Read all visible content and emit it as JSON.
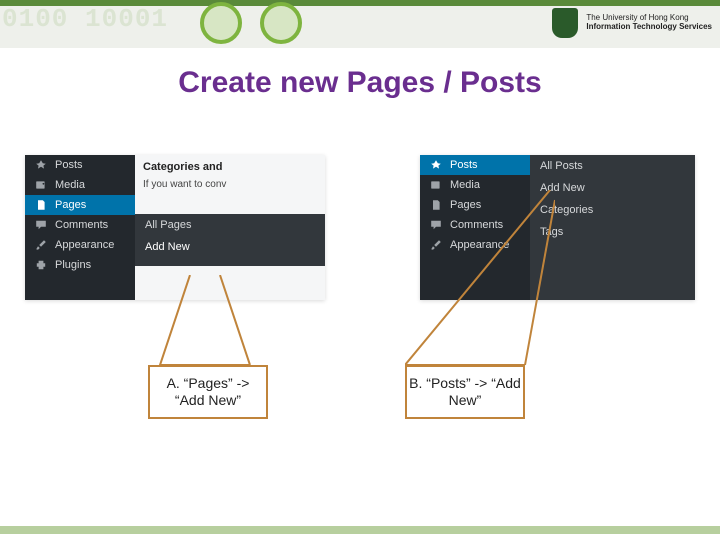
{
  "banner": {
    "binary_bg": "0100      10001",
    "org_line1": "The University of Hong Kong",
    "org_line2": "Information Technology Services"
  },
  "title": "Create new Pages / Posts",
  "shotA": {
    "side": {
      "posts": "Posts",
      "media": "Media",
      "pages": "Pages",
      "comments": "Comments",
      "appearance": "Appearance",
      "plugins": "Plugins"
    },
    "flyout": {
      "all": "All Pages",
      "add": "Add New"
    },
    "body": {
      "heading": "Categories and",
      "hint": "If you want to conv"
    }
  },
  "shotB": {
    "side": {
      "posts": "Posts",
      "media": "Media",
      "pages": "Pages",
      "comments": "Comments",
      "appearance": "Appearance"
    },
    "flyout": {
      "all": "All Posts",
      "add": "Add New",
      "cats": "Categories",
      "tags": "Tags"
    }
  },
  "callouts": {
    "a": "A. “Pages” -> “Add New”",
    "b": "B. “Posts” -> “Add New”"
  }
}
